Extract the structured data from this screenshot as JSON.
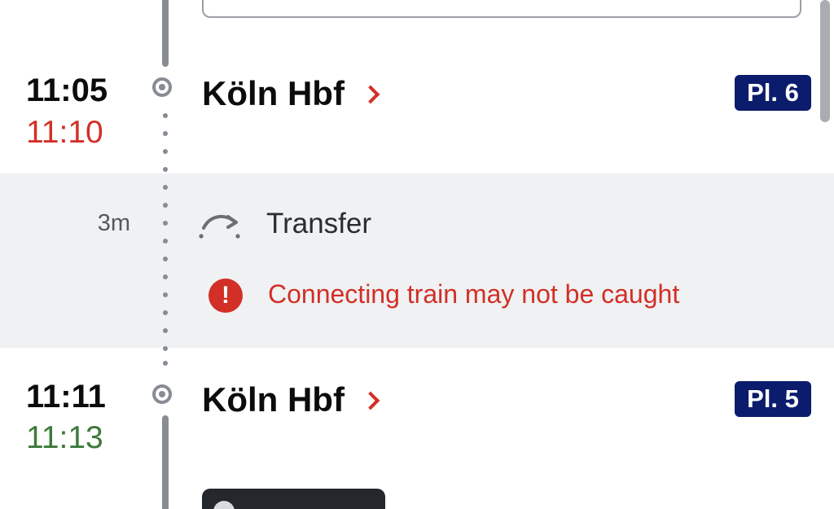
{
  "stops": [
    {
      "scheduled_time": "11:05",
      "actual_time": "11:10",
      "actual_status": "late",
      "station": "Köln Hbf",
      "platform": "Pl. 6"
    },
    {
      "scheduled_time": "11:11",
      "actual_time": "11:13",
      "actual_status": "on-time",
      "station": "Köln Hbf",
      "platform": "Pl. 5"
    }
  ],
  "transfer": {
    "duration": "3m",
    "label": "Transfer",
    "icon": "transfer-arrow-icon",
    "warning_icon": "exclamation-circle-icon",
    "warning": "Connecting train may not be caught"
  },
  "colors": {
    "late": "#d22f27",
    "on_time": "#3d7a3a",
    "platform_badge": "#0c1c6c",
    "warning": "#d22f27",
    "transfer_band": "#f0f1f2"
  }
}
